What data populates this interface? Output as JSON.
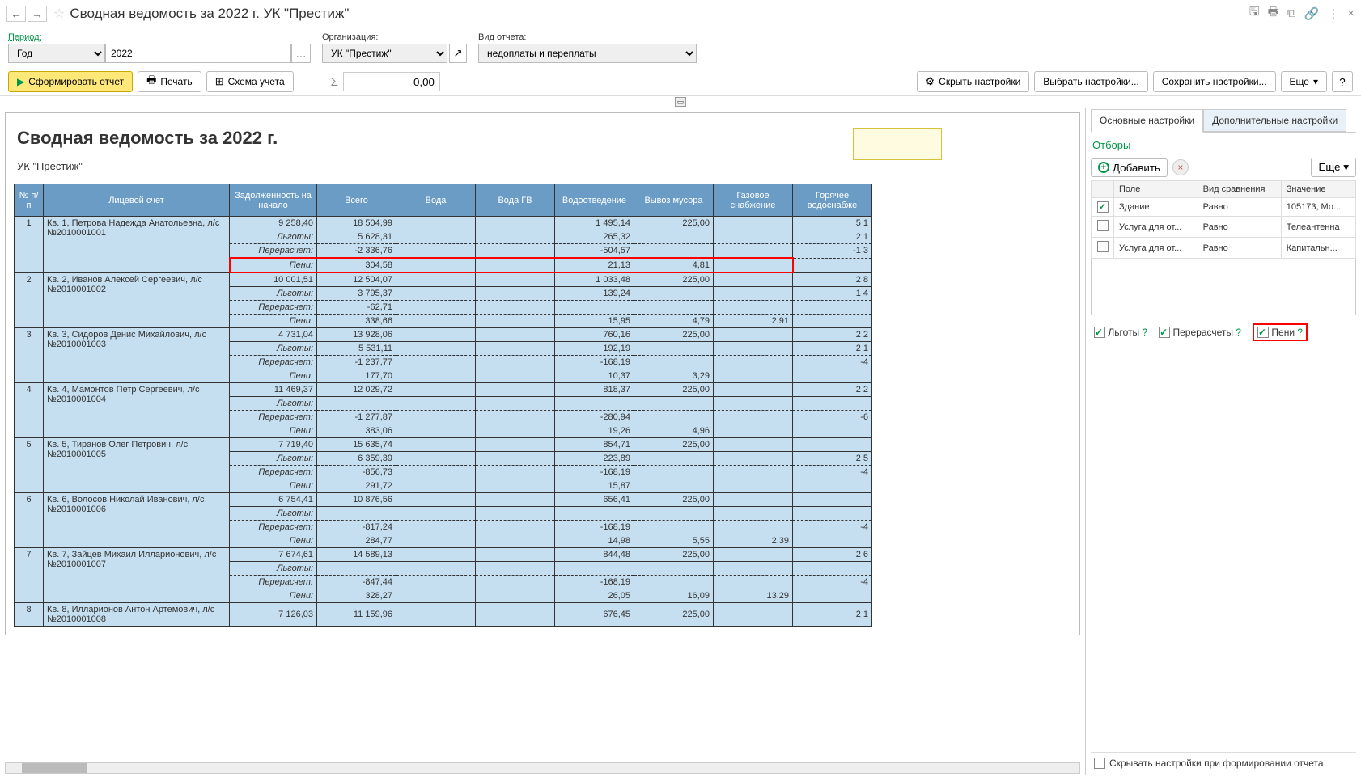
{
  "header": {
    "title": "Сводная ведомость за 2022 г. УК \"Престиж\""
  },
  "form": {
    "period_label": "Период:",
    "period_type": "Год",
    "period_value": "2022",
    "org_label": "Организация:",
    "org_value": "УК \"Престиж\"",
    "report_type_label": "Вид отчета:",
    "report_type_value": "недоплаты и переплаты"
  },
  "actions": {
    "form_report": "Сформировать отчет",
    "print": "Печать",
    "scheme": "Схема учета",
    "sigma_value": "0,00",
    "hide_settings": "Скрыть настройки",
    "choose_settings": "Выбрать настройки...",
    "save_settings": "Сохранить настройки...",
    "more": "Еще",
    "help": "?"
  },
  "report": {
    "title": "Сводная ведомость за 2022 г.",
    "subtitle": "УК \"Престиж\"",
    "headers": {
      "num": "№ п/п",
      "account": "Лицевой счет",
      "debt": "Задолженность на начало",
      "total": "Всего",
      "water": "Вода",
      "water_hot": "Вода ГВ",
      "sewer": "Водоотведение",
      "garbage": "Вывоз мусора",
      "gas": "Газовое снабжение",
      "hot_supply": "Горячее водоснабже"
    },
    "sub_labels": {
      "lgoty": "Льготы:",
      "recalc": "Перерасчет:",
      "peni": "Пени:"
    },
    "rows": [
      {
        "num": "1",
        "account": "Кв. 1, Петрова Надежда Анатольевна, л/с №2010001001",
        "debt": "9 258,40",
        "main": {
          "total": "18 504,99",
          "water": "",
          "water_hot": "",
          "sewer": "1 495,14",
          "garbage": "225,00",
          "gas": "",
          "hot": "5 1"
        },
        "lgoty": {
          "total": "5 628,31",
          "sewer": "265,32",
          "garbage": "",
          "gas": "",
          "hot": "2 1"
        },
        "recalc": {
          "total": "-2 336,76",
          "sewer": "-504,57",
          "garbage": "",
          "gas": "",
          "hot": "-1 3"
        },
        "peni": {
          "total": "304,58",
          "sewer": "21,13",
          "garbage": "4,81",
          "gas": "",
          "hot": ""
        },
        "peni_highlight": true
      },
      {
        "num": "2",
        "account": "Кв. 2, Иванов Алексей Сергеевич, л/с №2010001002",
        "debt": "10 001,51",
        "main": {
          "total": "12 504,07",
          "water": "",
          "water_hot": "",
          "sewer": "1 033,48",
          "garbage": "225,00",
          "gas": "",
          "hot": "2 8"
        },
        "lgoty": {
          "total": "3 795,37",
          "sewer": "139,24",
          "garbage": "",
          "gas": "",
          "hot": "1 4"
        },
        "recalc": {
          "total": "-62,71",
          "sewer": "",
          "garbage": "",
          "gas": "",
          "hot": ""
        },
        "peni": {
          "total": "338,66",
          "sewer": "15,95",
          "garbage": "4,79",
          "gas": "2,91",
          "hot": ""
        }
      },
      {
        "num": "3",
        "account": "Кв. 3, Сидоров Денис Михайлович, л/с №2010001003",
        "debt": "4 731,04",
        "main": {
          "total": "13 928,06",
          "water": "",
          "water_hot": "",
          "sewer": "760,16",
          "garbage": "225,00",
          "gas": "",
          "hot": "2 2"
        },
        "lgoty": {
          "total": "5 531,11",
          "sewer": "192,19",
          "garbage": "",
          "gas": "",
          "hot": "2 1"
        },
        "recalc": {
          "total": "-1 237,77",
          "sewer": "-168,19",
          "garbage": "",
          "gas": "",
          "hot": "-4"
        },
        "peni": {
          "total": "177,70",
          "sewer": "10,37",
          "garbage": "3,29",
          "gas": "",
          "hot": ""
        }
      },
      {
        "num": "4",
        "account": "Кв. 4, Мамонтов Петр Сергеевич, л/с №2010001004",
        "debt": "11 469,37",
        "main": {
          "total": "12 029,72",
          "water": "",
          "water_hot": "",
          "sewer": "818,37",
          "garbage": "225,00",
          "gas": "",
          "hot": "2 2"
        },
        "lgoty": {
          "total": "",
          "sewer": "",
          "garbage": "",
          "gas": "",
          "hot": ""
        },
        "recalc": {
          "total": "-1 277,87",
          "sewer": "-280,94",
          "garbage": "",
          "gas": "",
          "hot": "-6"
        },
        "peni": {
          "total": "383,06",
          "sewer": "19,26",
          "garbage": "4,96",
          "gas": "",
          "hot": ""
        }
      },
      {
        "num": "5",
        "account": "Кв. 5, Тиранов Олег Петрович, л/с №2010001005",
        "debt": "7 719,40",
        "main": {
          "total": "15 635,74",
          "water": "",
          "water_hot": "",
          "sewer": "854,71",
          "garbage": "225,00",
          "gas": "",
          "hot": ""
        },
        "lgoty": {
          "total": "6 359,39",
          "sewer": "223,89",
          "garbage": "",
          "gas": "",
          "hot": "2 5"
        },
        "recalc": {
          "total": "-856,73",
          "sewer": "-168,19",
          "garbage": "",
          "gas": "",
          "hot": "-4"
        },
        "peni": {
          "total": "291,72",
          "sewer": "15,87",
          "garbage": "",
          "gas": "",
          "hot": ""
        }
      },
      {
        "num": "6",
        "account": "Кв. 6, Волосов Николай Иванович, л/с №2010001006",
        "debt": "6 754,41",
        "main": {
          "total": "10 876,56",
          "water": "",
          "water_hot": "",
          "sewer": "656,41",
          "garbage": "225,00",
          "gas": "",
          "hot": ""
        },
        "lgoty": {
          "total": "",
          "sewer": "",
          "garbage": "",
          "gas": "",
          "hot": ""
        },
        "recalc": {
          "total": "-817,24",
          "sewer": "-168,19",
          "garbage": "",
          "gas": "",
          "hot": "-4"
        },
        "peni": {
          "total": "284,77",
          "sewer": "14,98",
          "garbage": "5,55",
          "gas": "2,39",
          "hot": ""
        }
      },
      {
        "num": "7",
        "account": "Кв. 7, Зайцев Михаил Илларионович, л/с №2010001007",
        "debt": "7 674,61",
        "main": {
          "total": "14 589,13",
          "water": "",
          "water_hot": "",
          "sewer": "844,48",
          "garbage": "225,00",
          "gas": "",
          "hot": "2 6"
        },
        "lgoty": {
          "total": "",
          "sewer": "",
          "garbage": "",
          "gas": "",
          "hot": ""
        },
        "recalc": {
          "total": "-847,44",
          "sewer": "-168,19",
          "garbage": "",
          "gas": "",
          "hot": "-4"
        },
        "peni": {
          "total": "328,27",
          "sewer": "26,05",
          "garbage": "16,09",
          "gas": "13,29",
          "hot": ""
        }
      },
      {
        "num": "8",
        "account": "Кв. 8, Илларионов Антон Артемович, л/с №2010001008",
        "debt": "7 126,03",
        "main": {
          "total": "11 159,96",
          "water": "",
          "water_hot": "",
          "sewer": "676,45",
          "garbage": "225,00",
          "gas": "",
          "hot": "2 1"
        }
      }
    ]
  },
  "settings": {
    "tabs": {
      "main": "Основные настройки",
      "extra": "Дополнительные настройки"
    },
    "filters_title": "Отборы",
    "add": "Добавить",
    "more": "Еще",
    "filter_headers": {
      "field": "Поле",
      "cmp": "Вид сравнения",
      "val": "Значение"
    },
    "filter_rows": [
      {
        "checked": true,
        "field": "Здание",
        "cmp": "Равно",
        "val": "105173, Мо..."
      },
      {
        "checked": false,
        "field": "Услуга для от...",
        "cmp": "Равно",
        "val": "Телеантенна"
      },
      {
        "checked": false,
        "field": "Услуга для от...",
        "cmp": "Равно",
        "val": "Капитальн..."
      }
    ],
    "checks": {
      "lgoty": "Льготы",
      "recalc": "Перерасчеты",
      "peni": "Пени"
    },
    "bottom": "Скрывать настройки при формировании отчета"
  }
}
